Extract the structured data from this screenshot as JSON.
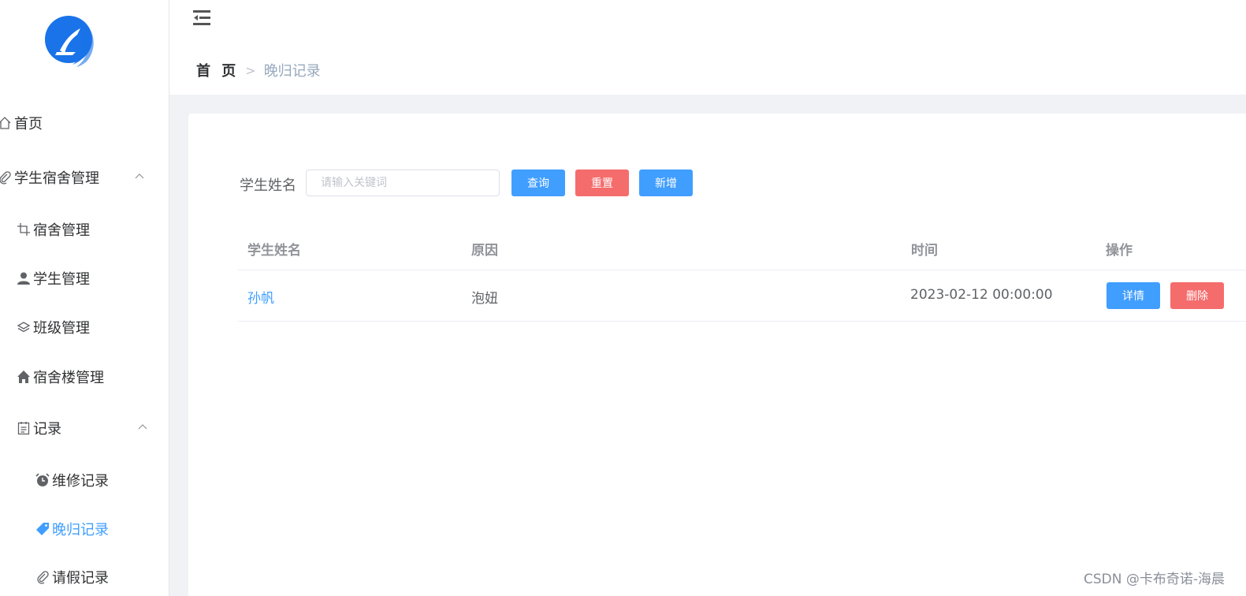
{
  "sidebar": {
    "logo_icon": "brand-logo",
    "items": [
      {
        "label": "首页",
        "icon": "home-icon"
      },
      {
        "label": "学生宿舍管理",
        "icon": "paperclip-icon",
        "expanded": true
      },
      {
        "label": "宿舍管理",
        "icon": "crop-icon"
      },
      {
        "label": "学生管理",
        "icon": "user-icon"
      },
      {
        "label": "班级管理",
        "icon": "layers-icon"
      },
      {
        "label": "宿舍楼管理",
        "icon": "house-icon"
      },
      {
        "label": "记录",
        "icon": "document-icon",
        "expanded": true
      },
      {
        "label": "维修记录",
        "icon": "alarm-clock-icon"
      },
      {
        "label": "晚归记录",
        "icon": "tag-icon",
        "active": true
      },
      {
        "label": "请假记录",
        "icon": "paperclip-icon"
      }
    ]
  },
  "header": {
    "menu_icon": "fold-menu-icon",
    "breadcrumb": {
      "home": "首 页",
      "current": "晚归记录"
    }
  },
  "search": {
    "label": "学生姓名",
    "placeholder": "请输入关键词",
    "value": "",
    "query_label": "查询",
    "reset_label": "重置",
    "add_label": "新增"
  },
  "table": {
    "columns": [
      "学生姓名",
      "原因",
      "时间",
      "操作"
    ],
    "rows": [
      {
        "name": "孙帆",
        "reason": "泡妞",
        "time": "2023-02-12 00:00:00",
        "detail_label": "详情",
        "delete_label": "删除"
      }
    ]
  },
  "watermark": "CSDN @卡布奇诺-海晨",
  "colors": {
    "primary": "#409eff",
    "danger": "#f56c6c",
    "background": "#f0f2f5"
  }
}
